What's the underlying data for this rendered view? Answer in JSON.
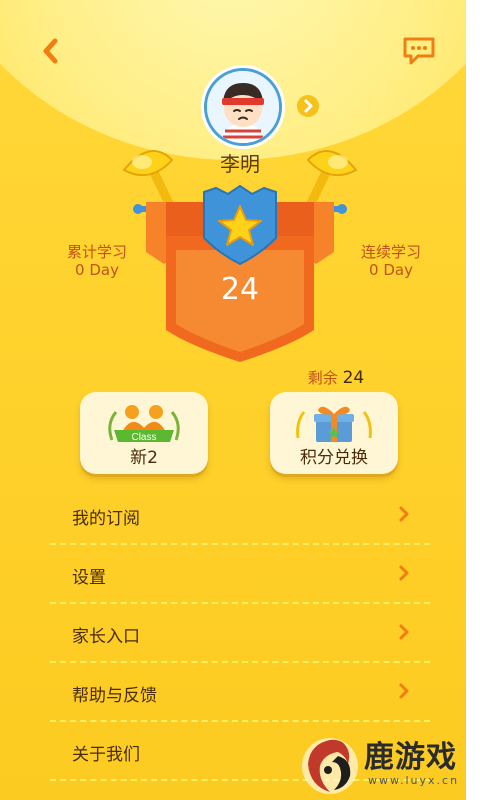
{
  "profile": {
    "name": "李明"
  },
  "stats": {
    "cumulative_label": "累计学习",
    "cumulative_value": "0 Day",
    "consecutive_label": "连续学习",
    "consecutive_value": "0 Day",
    "main_value": "24"
  },
  "remaining": {
    "label": "剩余",
    "value": "24"
  },
  "cards": {
    "class_badge": "Class",
    "class_label": "新2",
    "points_label": "积分兑换"
  },
  "menu": {
    "items": [
      {
        "label": "我的订阅"
      },
      {
        "label": "设置"
      },
      {
        "label": "家长入口"
      },
      {
        "label": "帮助与反馈"
      },
      {
        "label": "关于我们"
      }
    ]
  },
  "watermark": {
    "text": "鹿游戏",
    "url": "www.luyx.cn"
  },
  "colors": {
    "background": "#ffd22d",
    "accent": "#f27d12",
    "banner": "#f0691e",
    "shield": "#3f94d9"
  },
  "icons": {
    "back": "chevron-left-icon",
    "message": "message-icon",
    "profile": "chevron-right-icon",
    "menu": "chevron-right-icon"
  }
}
